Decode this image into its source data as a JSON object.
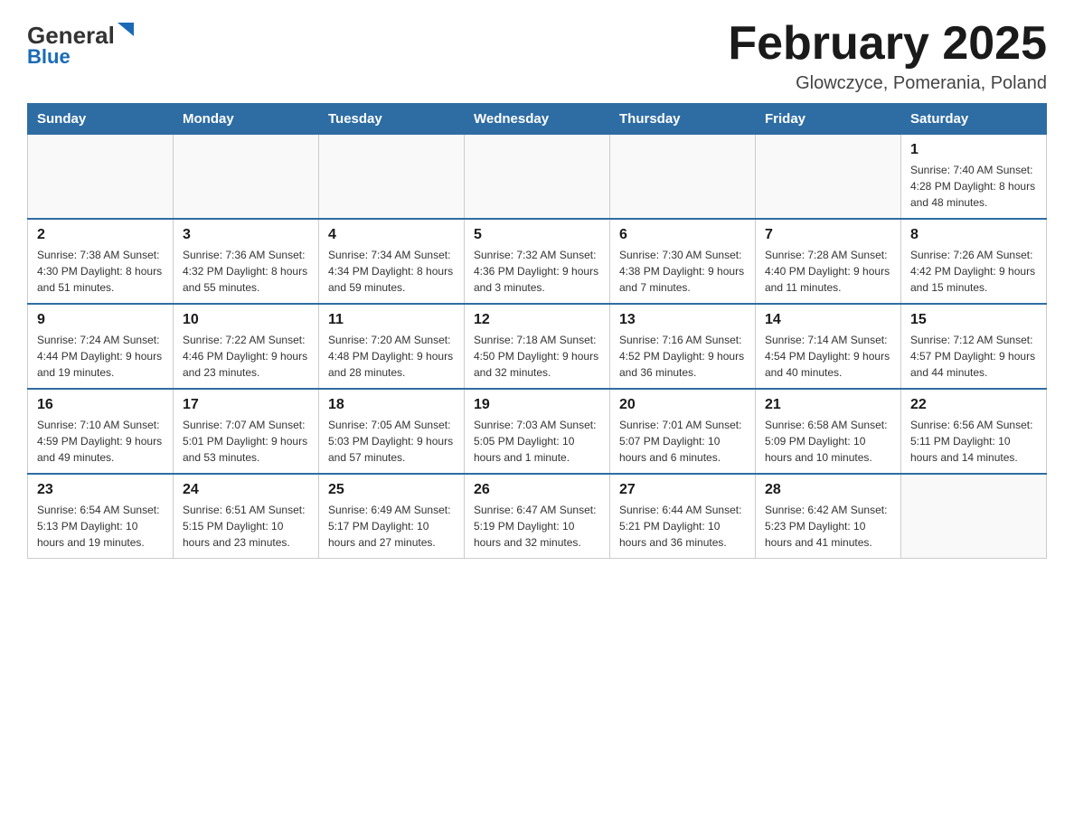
{
  "header": {
    "logo_general": "General",
    "logo_blue": "Blue",
    "month_title": "February 2025",
    "location": "Glowczyce, Pomerania, Poland"
  },
  "weekdays": [
    "Sunday",
    "Monday",
    "Tuesday",
    "Wednesday",
    "Thursday",
    "Friday",
    "Saturday"
  ],
  "weeks": [
    [
      {
        "day": "",
        "info": ""
      },
      {
        "day": "",
        "info": ""
      },
      {
        "day": "",
        "info": ""
      },
      {
        "day": "",
        "info": ""
      },
      {
        "day": "",
        "info": ""
      },
      {
        "day": "",
        "info": ""
      },
      {
        "day": "1",
        "info": "Sunrise: 7:40 AM\nSunset: 4:28 PM\nDaylight: 8 hours\nand 48 minutes."
      }
    ],
    [
      {
        "day": "2",
        "info": "Sunrise: 7:38 AM\nSunset: 4:30 PM\nDaylight: 8 hours\nand 51 minutes."
      },
      {
        "day": "3",
        "info": "Sunrise: 7:36 AM\nSunset: 4:32 PM\nDaylight: 8 hours\nand 55 minutes."
      },
      {
        "day": "4",
        "info": "Sunrise: 7:34 AM\nSunset: 4:34 PM\nDaylight: 8 hours\nand 59 minutes."
      },
      {
        "day": "5",
        "info": "Sunrise: 7:32 AM\nSunset: 4:36 PM\nDaylight: 9 hours\nand 3 minutes."
      },
      {
        "day": "6",
        "info": "Sunrise: 7:30 AM\nSunset: 4:38 PM\nDaylight: 9 hours\nand 7 minutes."
      },
      {
        "day": "7",
        "info": "Sunrise: 7:28 AM\nSunset: 4:40 PM\nDaylight: 9 hours\nand 11 minutes."
      },
      {
        "day": "8",
        "info": "Sunrise: 7:26 AM\nSunset: 4:42 PM\nDaylight: 9 hours\nand 15 minutes."
      }
    ],
    [
      {
        "day": "9",
        "info": "Sunrise: 7:24 AM\nSunset: 4:44 PM\nDaylight: 9 hours\nand 19 minutes."
      },
      {
        "day": "10",
        "info": "Sunrise: 7:22 AM\nSunset: 4:46 PM\nDaylight: 9 hours\nand 23 minutes."
      },
      {
        "day": "11",
        "info": "Sunrise: 7:20 AM\nSunset: 4:48 PM\nDaylight: 9 hours\nand 28 minutes."
      },
      {
        "day": "12",
        "info": "Sunrise: 7:18 AM\nSunset: 4:50 PM\nDaylight: 9 hours\nand 32 minutes."
      },
      {
        "day": "13",
        "info": "Sunrise: 7:16 AM\nSunset: 4:52 PM\nDaylight: 9 hours\nand 36 minutes."
      },
      {
        "day": "14",
        "info": "Sunrise: 7:14 AM\nSunset: 4:54 PM\nDaylight: 9 hours\nand 40 minutes."
      },
      {
        "day": "15",
        "info": "Sunrise: 7:12 AM\nSunset: 4:57 PM\nDaylight: 9 hours\nand 44 minutes."
      }
    ],
    [
      {
        "day": "16",
        "info": "Sunrise: 7:10 AM\nSunset: 4:59 PM\nDaylight: 9 hours\nand 49 minutes."
      },
      {
        "day": "17",
        "info": "Sunrise: 7:07 AM\nSunset: 5:01 PM\nDaylight: 9 hours\nand 53 minutes."
      },
      {
        "day": "18",
        "info": "Sunrise: 7:05 AM\nSunset: 5:03 PM\nDaylight: 9 hours\nand 57 minutes."
      },
      {
        "day": "19",
        "info": "Sunrise: 7:03 AM\nSunset: 5:05 PM\nDaylight: 10 hours\nand 1 minute."
      },
      {
        "day": "20",
        "info": "Sunrise: 7:01 AM\nSunset: 5:07 PM\nDaylight: 10 hours\nand 6 minutes."
      },
      {
        "day": "21",
        "info": "Sunrise: 6:58 AM\nSunset: 5:09 PM\nDaylight: 10 hours\nand 10 minutes."
      },
      {
        "day": "22",
        "info": "Sunrise: 6:56 AM\nSunset: 5:11 PM\nDaylight: 10 hours\nand 14 minutes."
      }
    ],
    [
      {
        "day": "23",
        "info": "Sunrise: 6:54 AM\nSunset: 5:13 PM\nDaylight: 10 hours\nand 19 minutes."
      },
      {
        "day": "24",
        "info": "Sunrise: 6:51 AM\nSunset: 5:15 PM\nDaylight: 10 hours\nand 23 minutes."
      },
      {
        "day": "25",
        "info": "Sunrise: 6:49 AM\nSunset: 5:17 PM\nDaylight: 10 hours\nand 27 minutes."
      },
      {
        "day": "26",
        "info": "Sunrise: 6:47 AM\nSunset: 5:19 PM\nDaylight: 10 hours\nand 32 minutes."
      },
      {
        "day": "27",
        "info": "Sunrise: 6:44 AM\nSunset: 5:21 PM\nDaylight: 10 hours\nand 36 minutes."
      },
      {
        "day": "28",
        "info": "Sunrise: 6:42 AM\nSunset: 5:23 PM\nDaylight: 10 hours\nand 41 minutes."
      },
      {
        "day": "",
        "info": ""
      }
    ]
  ]
}
